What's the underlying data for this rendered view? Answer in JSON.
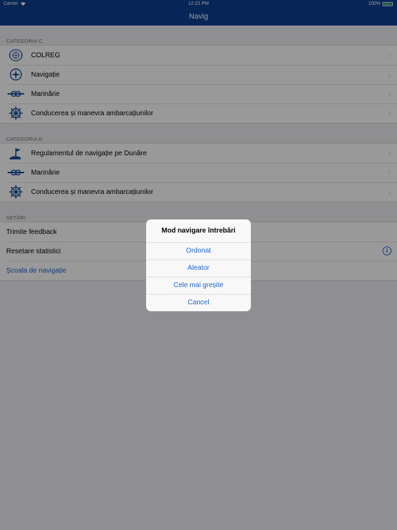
{
  "status_bar": {
    "carrier": "Carrier",
    "time": "12:22 PM",
    "battery": "100%"
  },
  "nav": {
    "title": "Navig"
  },
  "sections": {
    "c": {
      "header": "CATEGORIA C",
      "items": [
        {
          "label": "COLREG",
          "icon": "colreg-emblem-icon"
        },
        {
          "label": "Navigație",
          "icon": "compass-rose-icon"
        },
        {
          "label": "Marinărie",
          "icon": "rope-knot-icon"
        },
        {
          "label": "Conducerea și manevra ambarcațiunilor",
          "icon": "ship-wheel-icon"
        }
      ]
    },
    "d": {
      "header": "CATEGORIA D",
      "items": [
        {
          "label": "Regulamentul de navigație pe Dunăre",
          "icon": "flag-post-icon"
        },
        {
          "label": "Marinărie",
          "icon": "rope-knot-icon"
        },
        {
          "label": "Conducerea și manevra ambarcațiunilor",
          "icon": "ship-wheel-icon"
        }
      ]
    },
    "settings": {
      "header": "SETĂRI",
      "items": [
        {
          "label": "Trimite feedback"
        },
        {
          "label": "Resetare statistici"
        },
        {
          "label": "Școala de navigație"
        }
      ]
    }
  },
  "alert": {
    "title": "Mod navigare întrebări",
    "actions": [
      "Ordonat",
      "Aleator",
      "Cele mai greșite",
      "Cancel"
    ]
  },
  "colors": {
    "nav_bar": "#0d3e8f",
    "accent": "#1f64d6",
    "icon_blue": "#1b4f9c"
  }
}
